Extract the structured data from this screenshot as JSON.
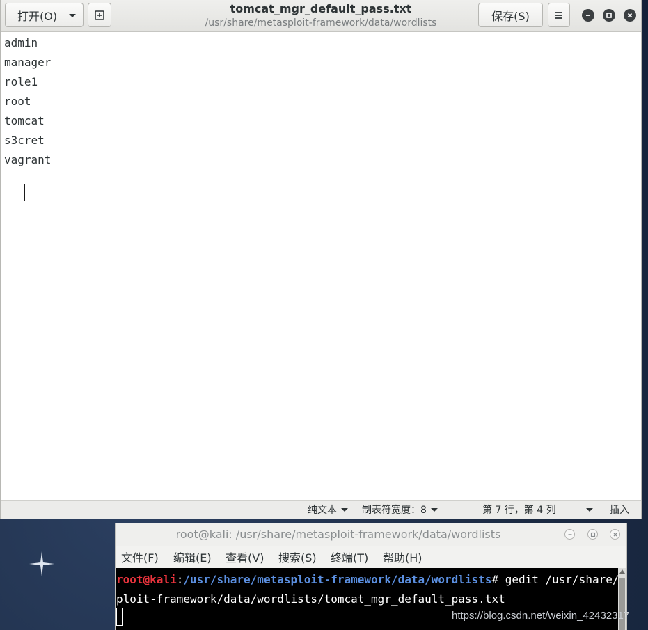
{
  "gedit": {
    "open_button": "打开(O)",
    "save_button": "保存(S)",
    "title": "tomcat_mgr_default_pass.txt",
    "subtitle": "/usr/share/metasploit-framework/data/wordlists",
    "lines": [
      "admin",
      "manager",
      "role1",
      "root",
      "tomcat",
      "s3cret",
      "vagrant"
    ],
    "status": {
      "language": "纯文本",
      "tab_width": "制表符宽度：8",
      "position": "第 7 行，第 4 列",
      "mode": "插入"
    }
  },
  "terminal": {
    "title": "root@kali: /usr/share/metasploit-framework/data/wordlists",
    "menu": [
      "文件(F)",
      "编辑(E)",
      "查看(V)",
      "搜索(S)",
      "终端(T)",
      "帮助(H)"
    ],
    "prompt_user": "root@kali",
    "prompt_sep": ":",
    "prompt_path": "/usr/share/metasploit-framework/data/wordlists",
    "command": "# gedit /usr/share/metas",
    "command_wrap": "ploit-framework/data/wordlists/tomcat_mgr_default_pass.txt"
  },
  "watermark": "https://blog.csdn.net/weixin_42432317",
  "colors": {
    "prompt_user": "#e8333c",
    "prompt_path": "#5b8fe0",
    "desktop": "#1d2c44"
  }
}
